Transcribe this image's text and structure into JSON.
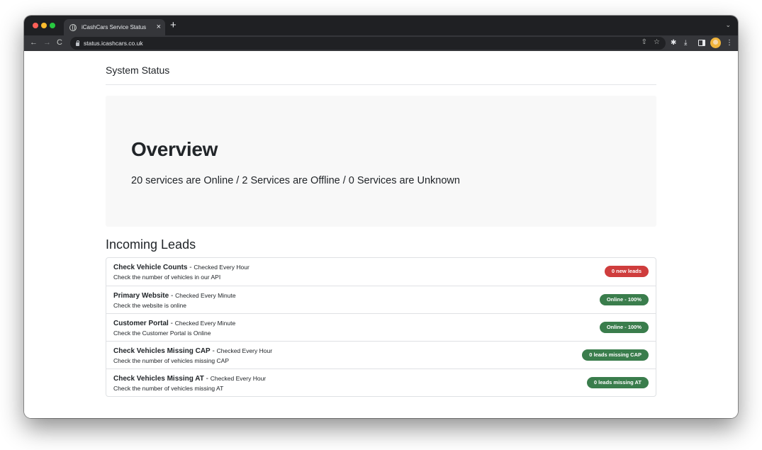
{
  "browser": {
    "tab_title": "iCashCars Service Status",
    "tab_close": "×",
    "new_tab": "+",
    "tab_search": "⌄",
    "url": "status.icashcars.co.uk",
    "icons": {
      "back": "←",
      "forward": "→",
      "reload": "C",
      "share": "⇧",
      "star": "☆",
      "extensions": "✱",
      "download": "⤓",
      "menu": "⋮"
    }
  },
  "page": {
    "header_title": "System Status",
    "overview": {
      "title": "Overview",
      "summary": "20 services are Online / 2 Services are Offline / 0 Services are Unknown"
    },
    "section_title": "Incoming Leads",
    "services": [
      {
        "name": "Check Vehicle Counts",
        "frequency": "Checked Every Hour",
        "description": "Check the number of vehicles in our API",
        "status": "0 new leads",
        "status_color": "#cf3d3d"
      },
      {
        "name": "Primary Website",
        "frequency": "Checked Every Minute",
        "description": "Check the website is online",
        "status": "Online - 100%",
        "status_color": "#3a7d4c"
      },
      {
        "name": "Customer Portal",
        "frequency": "Checked Every Minute",
        "description": "Check the Customer Portal is Online",
        "status": "Online - 100%",
        "status_color": "#3a7d4c"
      },
      {
        "name": "Check Vehicles Missing CAP",
        "frequency": "Checked Every Hour",
        "description": "Check the number of vehicles missing CAP",
        "status": "0 leads missing CAP",
        "status_color": "#3a7d4c"
      },
      {
        "name": "Check Vehicles Missing AT",
        "frequency": "Checked Every Hour",
        "description": "Check the number of vehicles missing AT",
        "status": "0 leads missing AT",
        "status_color": "#3a7d4c"
      }
    ]
  }
}
